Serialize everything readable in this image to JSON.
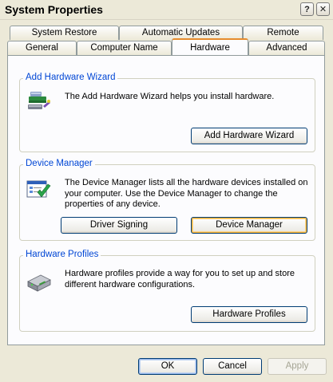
{
  "window": {
    "title": "System Properties",
    "help_label": "?",
    "close_label": "✕"
  },
  "tabs_back": [
    "System Restore",
    "Automatic Updates",
    "Remote"
  ],
  "tabs_front": [
    "General",
    "Computer Name",
    "Hardware",
    "Advanced"
  ],
  "active_tab": "Hardware",
  "groups": {
    "add_hardware": {
      "title": "Add Hardware Wizard",
      "description": "The Add Hardware Wizard helps you install hardware.",
      "button": "Add Hardware Wizard"
    },
    "device_manager": {
      "title": "Device Manager",
      "description": "The Device Manager lists all the hardware devices installed on your computer. Use the Device Manager to change the properties of any device.",
      "button_signing": "Driver Signing",
      "button_manager": "Device Manager"
    },
    "hardware_profiles": {
      "title": "Hardware Profiles",
      "description": "Hardware profiles provide a way for you to set up and store different hardware configurations.",
      "button": "Hardware Profiles"
    }
  },
  "footer": {
    "ok": "OK",
    "cancel": "Cancel",
    "apply": "Apply"
  },
  "colors": {
    "group_title": "#0046d5",
    "active_tab_accent": "#e68b2c",
    "dialog_bg": "#ece9d8"
  }
}
